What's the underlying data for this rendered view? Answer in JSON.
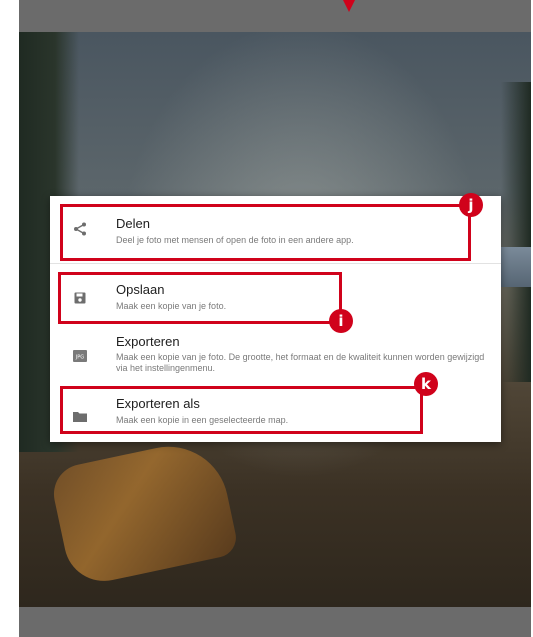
{
  "menu": {
    "items": [
      {
        "title": "Delen",
        "description": "Deel je foto met mensen of open de foto in een andere app.",
        "icon": "share-icon"
      },
      {
        "title": "Opslaan",
        "description": "Maak een kopie van je foto.",
        "icon": "save-icon"
      },
      {
        "title": "Exporteren",
        "description": "Maak een kopie van je foto. De grootte, het formaat en de kwaliteit kunnen worden gewijzigd via het instellingenmenu.",
        "icon": "jpg-file-icon"
      },
      {
        "title": "Exporteren als",
        "description": "Maak een kopie in een geselecteerde map.",
        "icon": "folder-icon"
      }
    ]
  },
  "annotations": {
    "j": "j",
    "i": "i",
    "k": "k"
  },
  "colors": {
    "highlight": "#d0021b",
    "menu_background": "#ffffff",
    "title_text": "#202020",
    "description_text": "#7a7a7a"
  }
}
